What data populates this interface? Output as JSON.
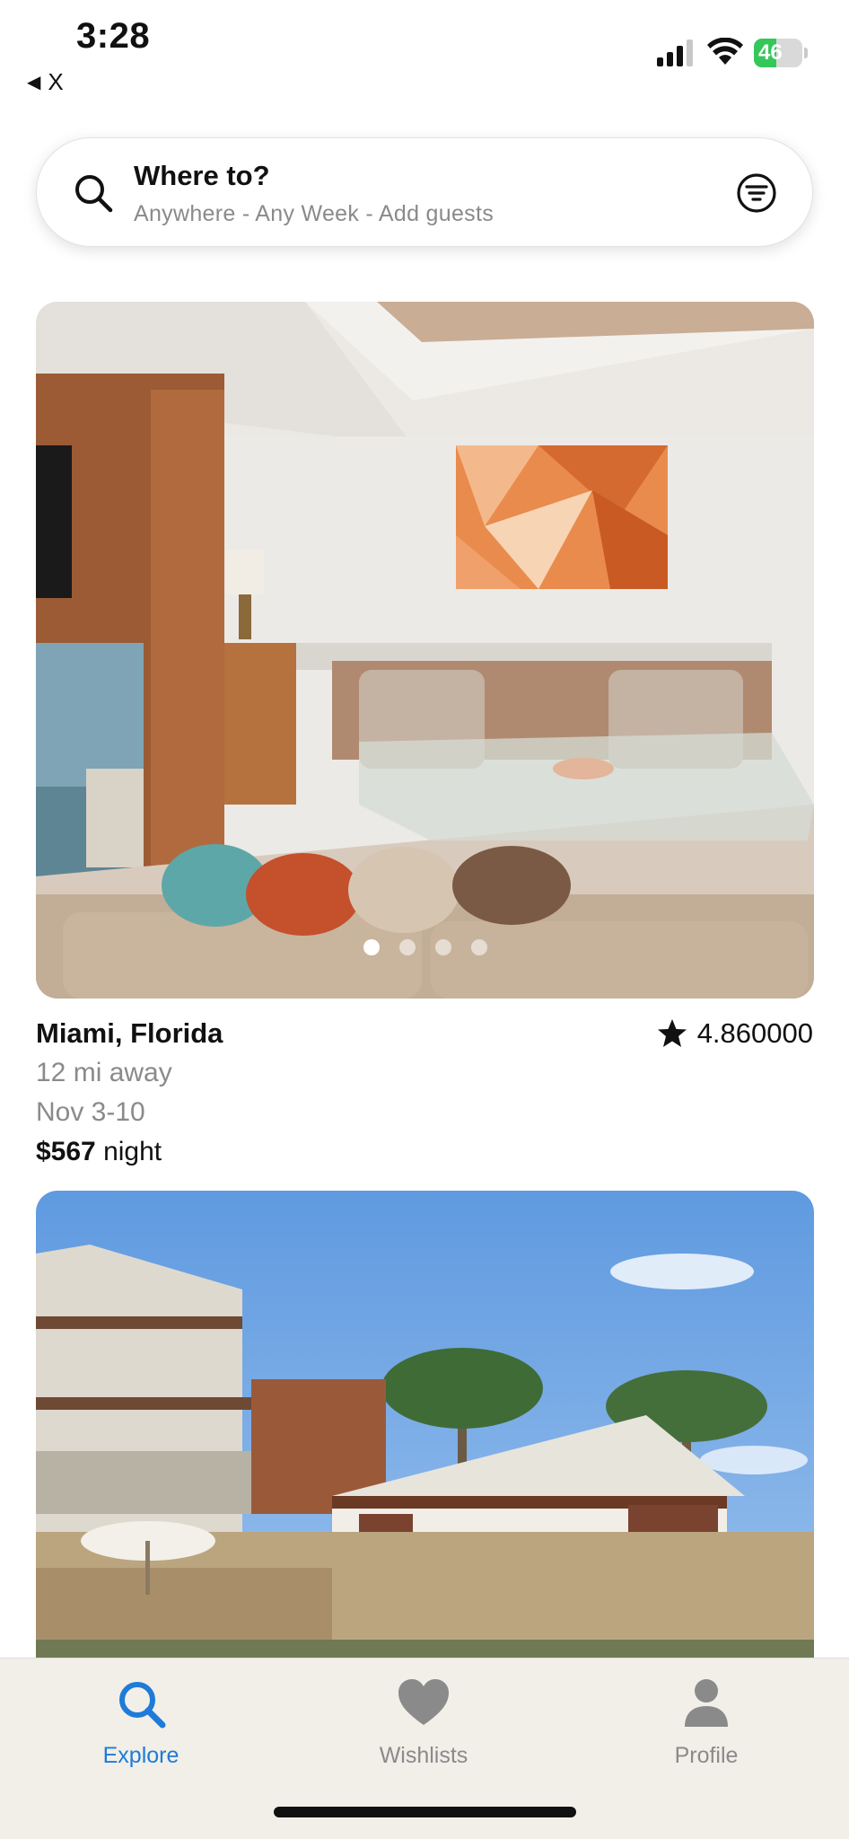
{
  "status": {
    "time": "3:28",
    "back_label": "X",
    "battery_percent": "46",
    "battery_level": 0.46
  },
  "search": {
    "title": "Where to?",
    "subtitle": "Anywhere - Any Week - Add guests"
  },
  "listings": [
    {
      "location": "Miami, Florida",
      "rating": "4.860000",
      "distance": "12 mi away",
      "dates": "Nov 3-10",
      "price": "$567",
      "price_unit": " night",
      "photo_count": 4,
      "active_photo": 1
    }
  ],
  "tabs": [
    {
      "label": "Explore",
      "icon": "search-icon",
      "active": true
    },
    {
      "label": "Wishlists",
      "icon": "heart-icon",
      "active": false
    },
    {
      "label": "Profile",
      "icon": "person-icon",
      "active": false
    }
  ],
  "colors": {
    "accent": "#1e7bd8",
    "battery_green": "#34c759",
    "muted_text": "#8a8a8a",
    "tab_bar_bg": "#f1efe8"
  }
}
